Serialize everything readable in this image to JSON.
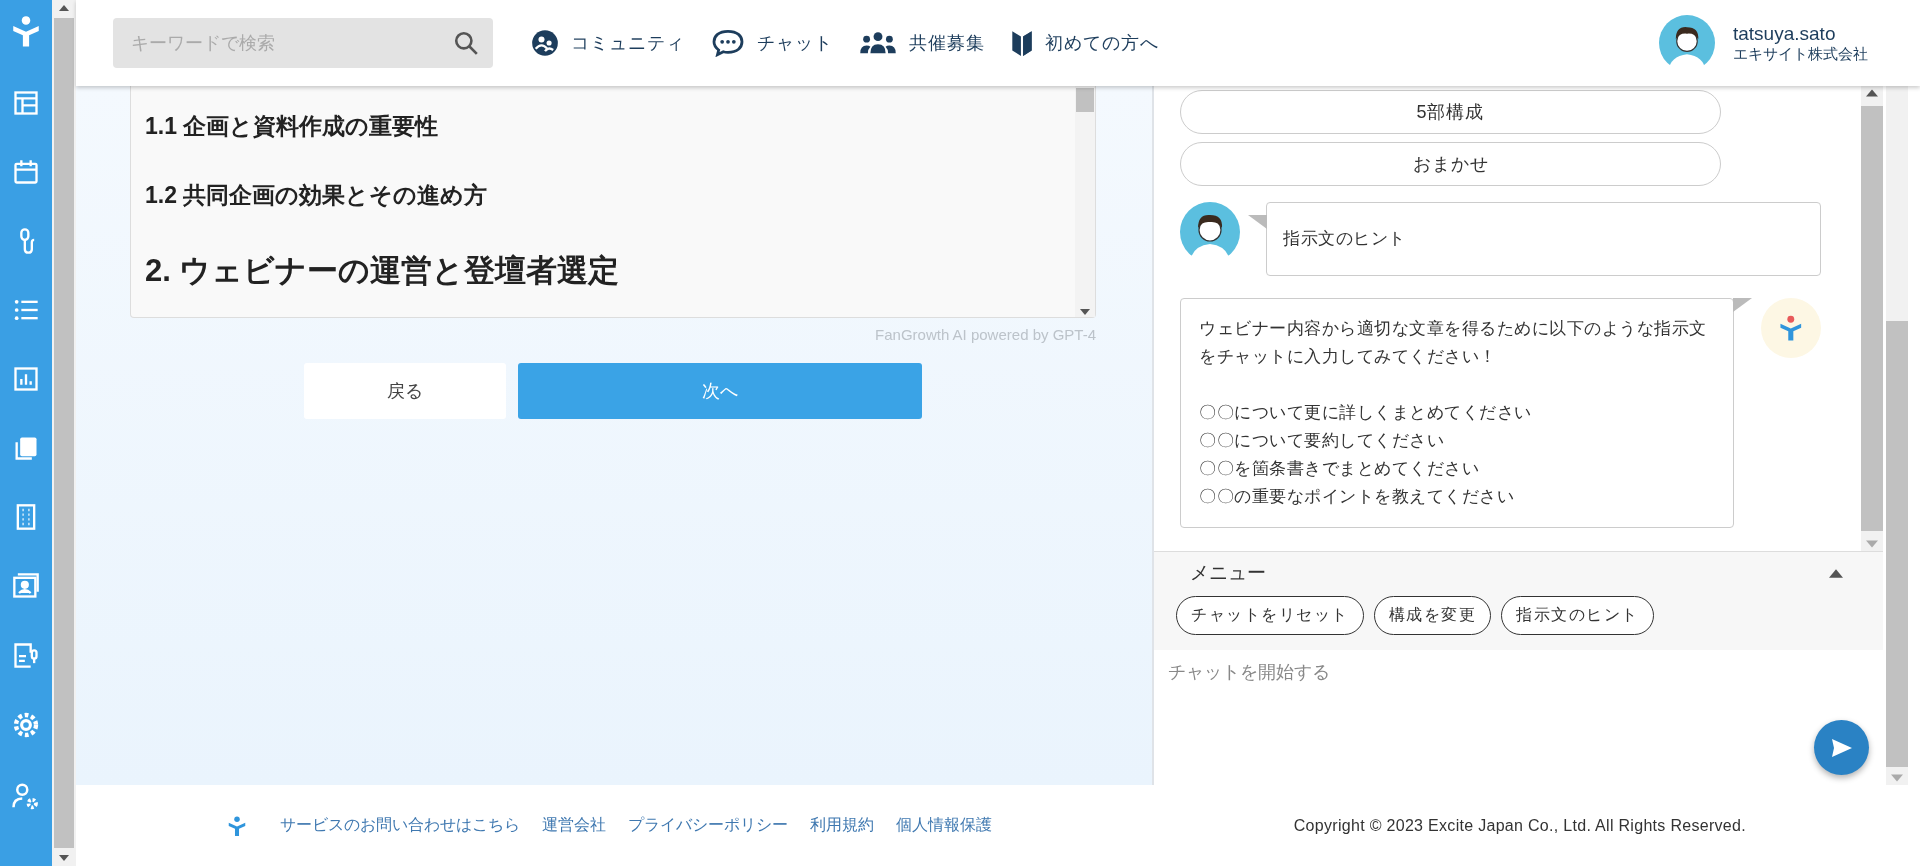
{
  "header": {
    "search": {
      "placeholder": "キーワードで検索"
    },
    "nav": [
      {
        "label": "コミュニティ",
        "kind": "community"
      },
      {
        "label": "チャット",
        "kind": "chat"
      },
      {
        "label": "共催募集",
        "kind": "cohost"
      },
      {
        "label": "初めての方へ",
        "kind": "beginner"
      }
    ],
    "user": {
      "name": "tatsuya.sato",
      "company": "エキサイト株式会社"
    }
  },
  "outline": {
    "headings": [
      {
        "text": "1.1 企画と資料作成の重要性",
        "kind": "subsection"
      },
      {
        "text": "1.2 共同企画の効果とその進め方",
        "kind": "subsection"
      },
      {
        "text": "2. ウェビナーの運営と登壇者選定",
        "kind": "section"
      }
    ],
    "caption": "FanGrowth AI powered by GPT-4"
  },
  "buttons": [
    {
      "label": "戻る",
      "kind": "secondary"
    },
    {
      "label": "次へ",
      "kind": "primary"
    }
  ],
  "chat": {
    "options": [
      "5部構成",
      "おまかせ"
    ],
    "messages": [
      {
        "kind": "user",
        "lines": [
          "指示文のヒント"
        ]
      },
      {
        "kind": "bot",
        "lines": [
          "ウェビナー内容から適切な文章を得るために以下のような指示文をチャットに入力してみてください！",
          "〇〇について更に詳しくまとめてください",
          "〇〇について要約してください",
          "〇〇を箇条書きでまとめてください",
          "〇〇の重要なポイントを教えてください"
        ]
      }
    ],
    "menu": {
      "title": "メニュー",
      "expanded": true,
      "chips": [
        "チャットをリセット",
        "構成を変更",
        "指示文のヒント"
      ]
    },
    "input": {
      "placeholder": "チャットを開始する"
    }
  },
  "footer": {
    "links": [
      "サービスのお問い合わせはこちら",
      "運営会社",
      "プライバシーポリシー",
      "利用規約",
      "個人情報保護"
    ],
    "copyright": "Copyright © 2023 Excite Japan Co., Ltd. All Rights Reserved."
  }
}
